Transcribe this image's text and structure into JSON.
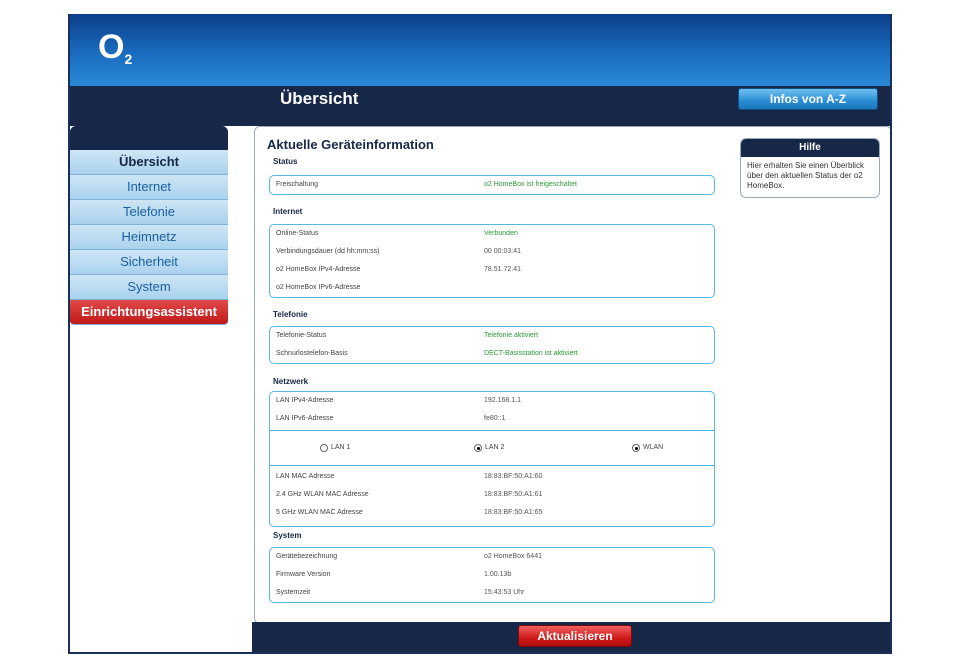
{
  "brand": {
    "logo_text": "O",
    "logo_sub": "2"
  },
  "header": {
    "page_title": "Übersicht",
    "infos_label": "Infos von A-Z"
  },
  "sidebar": {
    "items": [
      {
        "label": "Übersicht",
        "active": true
      },
      {
        "label": "Internet"
      },
      {
        "label": "Telefonie"
      },
      {
        "label": "Heimnetz"
      },
      {
        "label": "Sicherheit"
      },
      {
        "label": "System"
      },
      {
        "label": "Einrichtungsassistent",
        "style": "wizard"
      }
    ]
  },
  "main": {
    "title": "Aktuelle Geräteinformation",
    "sections": {
      "status": {
        "label": "Status",
        "rows": [
          {
            "key": "Freischaltung",
            "value": "o2 HomeBox ist freigeschaltet"
          }
        ]
      },
      "internet": {
        "label": "Internet",
        "rows": [
          {
            "key": "Online-Status",
            "value": "Verbunden"
          },
          {
            "key": "Verbindungsdauer (dd hh:mm:ss)",
            "value": "00 00:03:41"
          },
          {
            "key": "o2 HomeBox IPv4-Adresse",
            "value": "78.51.72.41"
          },
          {
            "key": "o2 HomeBox IPv6-Adresse",
            "value": ""
          }
        ]
      },
      "telefonie": {
        "label": "Telefonie",
        "rows": [
          {
            "key": "Telefonie-Status",
            "value": "Telefonie aktiviert"
          },
          {
            "key": "Schnurlostelefon-Basis",
            "value": "DECT-Basisstation ist aktiviert"
          }
        ]
      },
      "netzwerk": {
        "label": "Netzwerk",
        "rows_top": [
          {
            "key": "LAN IPv4-Adresse",
            "value": "192.168.1.1"
          },
          {
            "key": "LAN IPv6-Adresse",
            "value": "fe80::1"
          }
        ],
        "radios": [
          {
            "label": "LAN 1",
            "selected": false
          },
          {
            "label": "LAN 2",
            "selected": true
          },
          {
            "label": "WLAN",
            "selected": true
          }
        ],
        "rows_bottom": [
          {
            "key": "LAN MAC Adresse",
            "value": "18:83:BF:50:A1:60"
          },
          {
            "key": "2.4 GHz WLAN MAC Adresse",
            "value": "18:83:BF:50:A1:61"
          },
          {
            "key": "5 GHz WLAN MAC Adresse",
            "value": "18:83:BF:50:A1:65"
          }
        ]
      },
      "system": {
        "label": "System",
        "rows": [
          {
            "key": "Gerätebezeichnung",
            "value": "o2 HomeBox 6441"
          },
          {
            "key": "Firmware Version",
            "value": "1.00.13b"
          },
          {
            "key": "Systemzeit",
            "value": "15:43:53 Uhr"
          }
        ]
      }
    }
  },
  "help": {
    "title": "Hilfe",
    "text": "Hier erhalten Sie einen Überblick über den aktuellen Status der o2 HomeBox."
  },
  "footer": {
    "update_label": "Aktualisieren"
  },
  "colors": {
    "navy": "#162747",
    "blue": "#1a6cc0",
    "accent_red": "#d01a1a",
    "status_green": "#2a9a3a",
    "box_border": "#55b8e0"
  }
}
